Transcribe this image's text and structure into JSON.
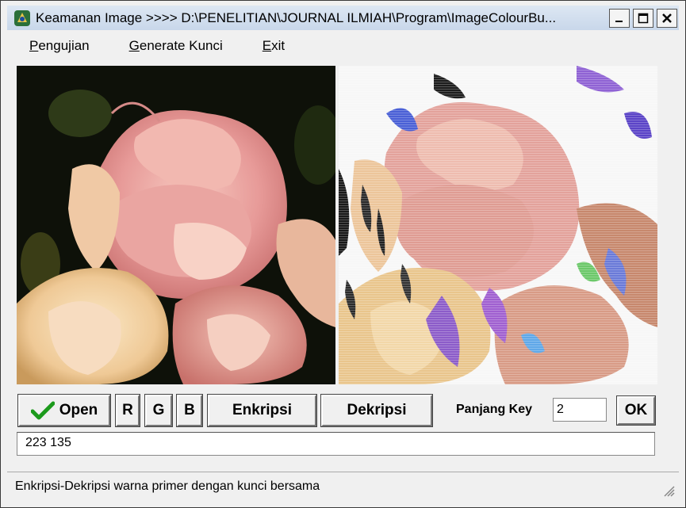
{
  "window": {
    "title": "Keamanan Image >>>> D:\\PENELITIAN\\JOURNAL ILMIAH\\Program\\ImageColourBu..."
  },
  "menu": {
    "items": [
      {
        "label": "Pengujian",
        "underline": "P",
        "rest": "engujian"
      },
      {
        "label": "Generate Kunci",
        "underline": "G",
        "rest": "enerate Kunci"
      },
      {
        "label": "Exit",
        "underline": "E",
        "rest": "xit"
      }
    ]
  },
  "toolbar": {
    "open_label": "Open",
    "r_label": "R",
    "g_label": "G",
    "b_label": "B",
    "encrypt_label": "Enkripsi",
    "decrypt_label": "Dekripsi",
    "key_length_label": "Panjang Key",
    "key_length_value": "2",
    "ok_label": "OK"
  },
  "output": {
    "value": "223 135"
  },
  "status": {
    "text": "Enkripsi-Dekripsi warna primer dengan kunci bersama"
  },
  "icons": {
    "app": "app-icon",
    "minimize": "minimize-icon",
    "maximize": "maximize-icon",
    "close": "close-icon",
    "checkmark": "checkmark-icon",
    "grip": "resize-grip-icon"
  },
  "colors": {
    "titlebar": "#c8d7ea",
    "checkmark": "#1c9a1c",
    "petal_pink": "#e8a0a0",
    "petal_cream": "#f3dcb0"
  }
}
